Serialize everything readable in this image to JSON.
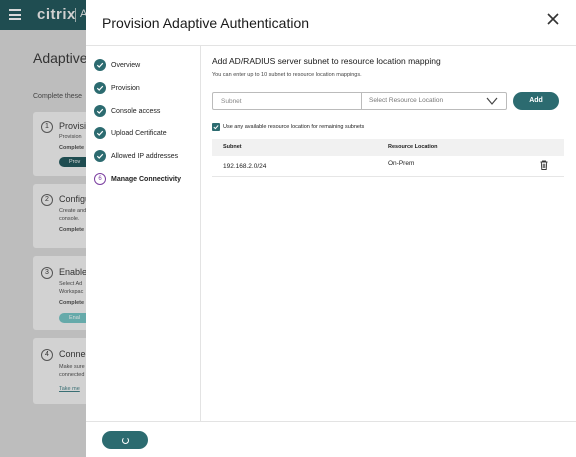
{
  "background": {
    "logo": "citrix",
    "logo_suffix": "A",
    "page_title": "Adaptive A",
    "subtitle": "Complete these",
    "cards": [
      {
        "number": "1",
        "title": "Provisi",
        "lines": [
          "Provision"
        ],
        "status": "Complete",
        "button": "Prov"
      },
      {
        "number": "2",
        "title": "Configu",
        "lines": [
          "Create and",
          "console."
        ],
        "status": "Complete",
        "button": ""
      },
      {
        "number": "3",
        "title": "Enable",
        "lines": [
          "Select Ad",
          "Workspac"
        ],
        "status": "Complete",
        "button": "Enal"
      },
      {
        "number": "4",
        "title": "Connec",
        "lines": [
          "Make sure",
          "connected"
        ],
        "status": "",
        "link": "Take me"
      }
    ]
  },
  "modal": {
    "title": "Provision Adaptive Authentication",
    "close_icon": "close-icon",
    "steps": [
      {
        "label": "Overview",
        "state": "done"
      },
      {
        "label": "Provision",
        "state": "done"
      },
      {
        "label": "Console access",
        "state": "done"
      },
      {
        "label": "Upload Certificate",
        "state": "done"
      },
      {
        "label": "Allowed IP addresses",
        "state": "done"
      },
      {
        "label": "Manage Connectivity",
        "state": "current",
        "number": "6"
      }
    ],
    "content": {
      "title": "Add AD/RADIUS server subnet to resource location mapping",
      "help": "You can enter up to 10 subnet to resource location mappings.",
      "subnet_placeholder": "Subnet",
      "location_placeholder": "Select Resource Location",
      "add_label": "Add",
      "checkbox_label": "Use any available resource location for remaining subnets",
      "checkbox_checked": true,
      "table": {
        "headers": [
          "Subnet",
          "Resource Location"
        ],
        "rows": [
          {
            "subnet": "192.168.2.0/24",
            "location": "On-Prem"
          }
        ]
      }
    },
    "colors": {
      "primary": "#2c6b70",
      "current_step": "#7b3fa0"
    }
  }
}
